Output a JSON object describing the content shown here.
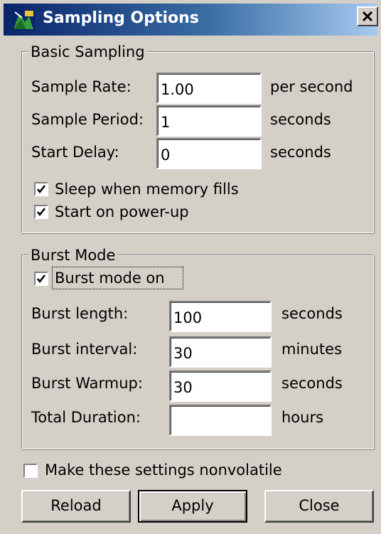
{
  "window": {
    "title": "Sampling Options",
    "icon": "app-icon",
    "close_icon": "close-icon",
    "close_glyph": "×",
    "title_gradient": [
      "#0a246a",
      "#a6caf0"
    ],
    "face_color": "#d4d0c8"
  },
  "basic": {
    "title": "Basic Sampling",
    "sample_rate_label": "Sample Rate:",
    "sample_rate_value": "1.00",
    "sample_rate_unit": "per second",
    "sample_period_label": "Sample Period:",
    "sample_period_value": "1",
    "sample_period_unit": "seconds",
    "start_delay_label": "Start Delay:",
    "start_delay_value": "0",
    "start_delay_unit": "seconds",
    "sleep_label": "Sleep when memory fills",
    "sleep_checked": true,
    "powerup_label": "Start on power-up",
    "powerup_checked": true
  },
  "burst": {
    "title": "Burst Mode",
    "burst_on_label": "Burst mode on",
    "burst_on_checked": true,
    "length_label": "Burst length:",
    "length_value": "100",
    "length_unit": "seconds",
    "interval_label": "Burst interval:",
    "interval_value": "30",
    "interval_unit": "minutes",
    "warmup_label": "Burst Warmup:",
    "warmup_value": "30",
    "warmup_unit": "seconds",
    "duration_label": "Total Duration:",
    "duration_value": "",
    "duration_unit": "hours"
  },
  "footer": {
    "nonvolatile_label": "Make these settings nonvolatile",
    "nonvolatile_checked": false,
    "reload_label": "Reload",
    "apply_label": "Apply",
    "close_label": "Close"
  }
}
